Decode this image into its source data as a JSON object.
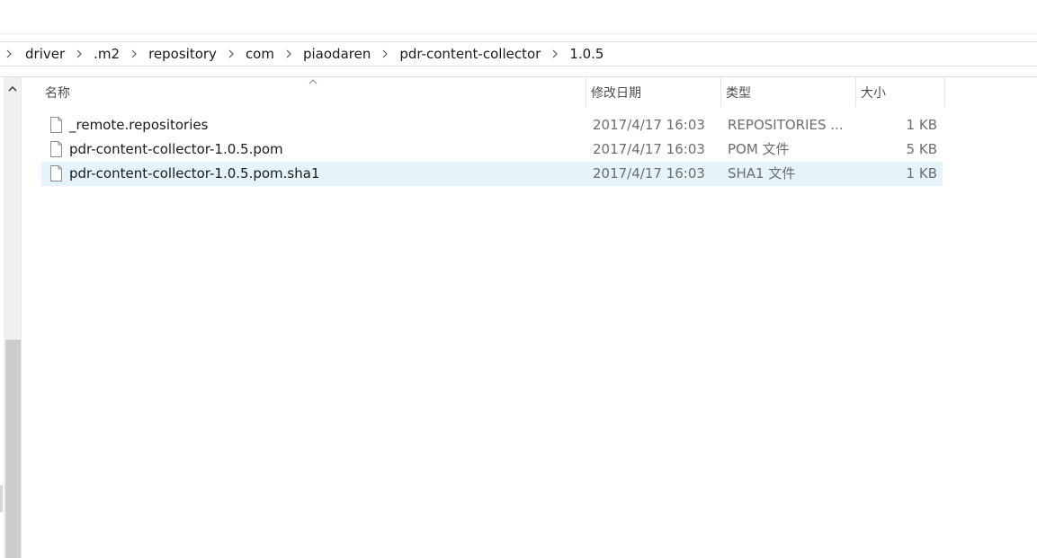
{
  "breadcrumb": [
    "driver",
    ".m2",
    "repository",
    "com",
    "piaodaren",
    "pdr-content-collector",
    "1.0.5"
  ],
  "columns": {
    "name": "名称",
    "date": "修改日期",
    "type": "类型",
    "size": "大小"
  },
  "files": [
    {
      "name": "_remote.repositories",
      "date": "2017/4/17 16:03",
      "type": "REPOSITORIES ...",
      "size": "1 KB",
      "selected": false
    },
    {
      "name": "pdr-content-collector-1.0.5.pom",
      "date": "2017/4/17 16:03",
      "type": "POM 文件",
      "size": "5 KB",
      "selected": false
    },
    {
      "name": "pdr-content-collector-1.0.5.pom.sha1",
      "date": "2017/4/17 16:03",
      "type": "SHA1 文件",
      "size": "1 KB",
      "selected": true
    }
  ],
  "icons": {
    "breadcrumb_separator": "chevron-right-icon",
    "file": "file-icon",
    "sort": "chevron-up-icon",
    "scroll_up": "chevron-up-icon"
  },
  "colors": {
    "selected_row": "#e5f3fb",
    "scrollbar_thumb": "#cdcdcd"
  }
}
